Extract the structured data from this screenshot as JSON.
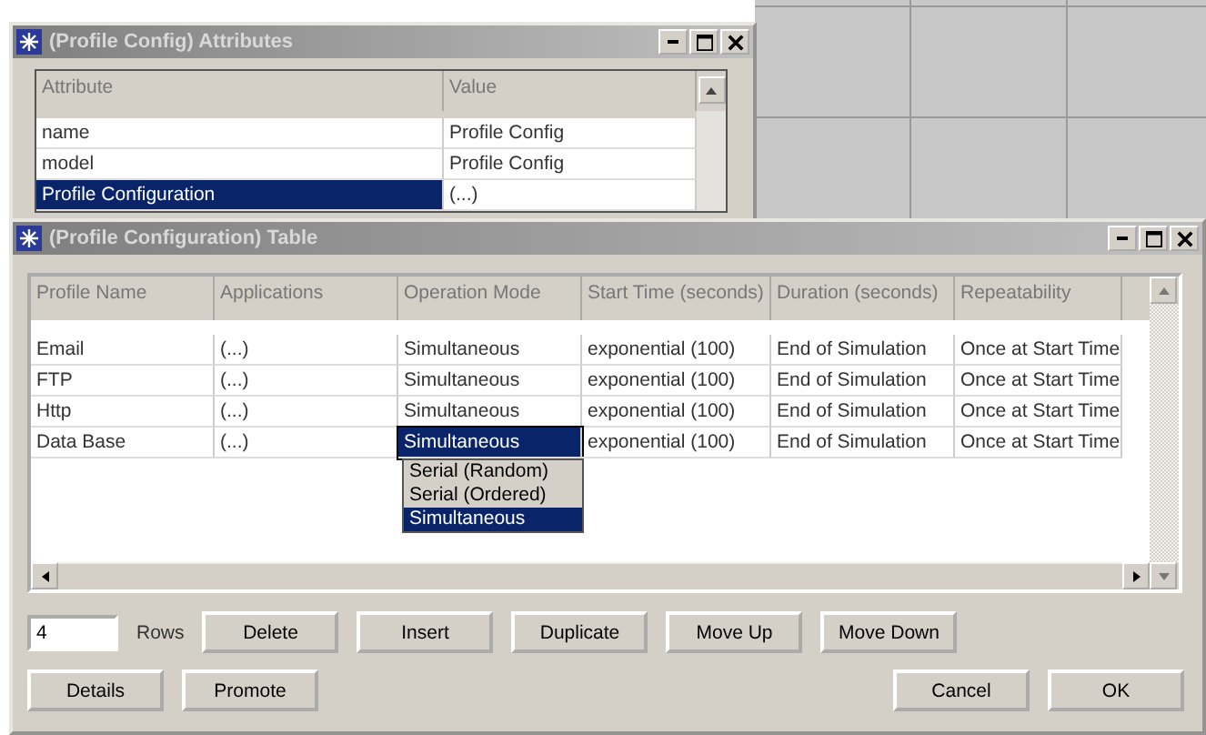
{
  "attributes_window": {
    "title": "(Profile Config) Attributes",
    "columns": [
      "Attribute",
      "Value"
    ],
    "rows": [
      {
        "attribute": "name",
        "value": "Profile Config",
        "selected": false
      },
      {
        "attribute": "model",
        "value": "Profile Config",
        "selected": false
      },
      {
        "attribute": "Profile Configuration",
        "value": "(...)",
        "selected": true
      }
    ]
  },
  "table_window": {
    "title": "(Profile Configuration) Table",
    "columns": [
      "Profile Name",
      "Applications",
      "Operation Mode",
      "Start Time (seconds)",
      "Duration (seconds)",
      "Repeatability"
    ],
    "rows": [
      {
        "cells": [
          "Email",
          "(...)",
          "Simultaneous",
          "exponential (100)",
          "End of Simulation",
          "Once at Start Time"
        ],
        "editing": false
      },
      {
        "cells": [
          "FTP",
          "(...)",
          "Simultaneous",
          "exponential (100)",
          "End of Simulation",
          "Once at Start Time"
        ],
        "editing": false
      },
      {
        "cells": [
          "Http",
          "(...)",
          "Simultaneous",
          "exponential (100)",
          "End of Simulation",
          "Once at Start Time"
        ],
        "editing": false
      },
      {
        "cells": [
          "Data Base",
          "(...)",
          "Simultaneous",
          "exponential (100)",
          "End of Simulation",
          "Once at Start Time"
        ],
        "editing": true
      }
    ],
    "dropdown_options": [
      {
        "label": "Serial (Random)",
        "selected": false
      },
      {
        "label": "Serial (Ordered)",
        "selected": false
      },
      {
        "label": "Simultaneous",
        "selected": true
      }
    ],
    "rows_field": {
      "value": "4",
      "label": "Rows"
    },
    "row_buttons": [
      "Delete",
      "Insert",
      "Duplicate",
      "Move Up",
      "Move Down"
    ],
    "left_buttons": [
      "Details",
      "Promote"
    ],
    "right_buttons": [
      "Cancel",
      "OK"
    ]
  }
}
